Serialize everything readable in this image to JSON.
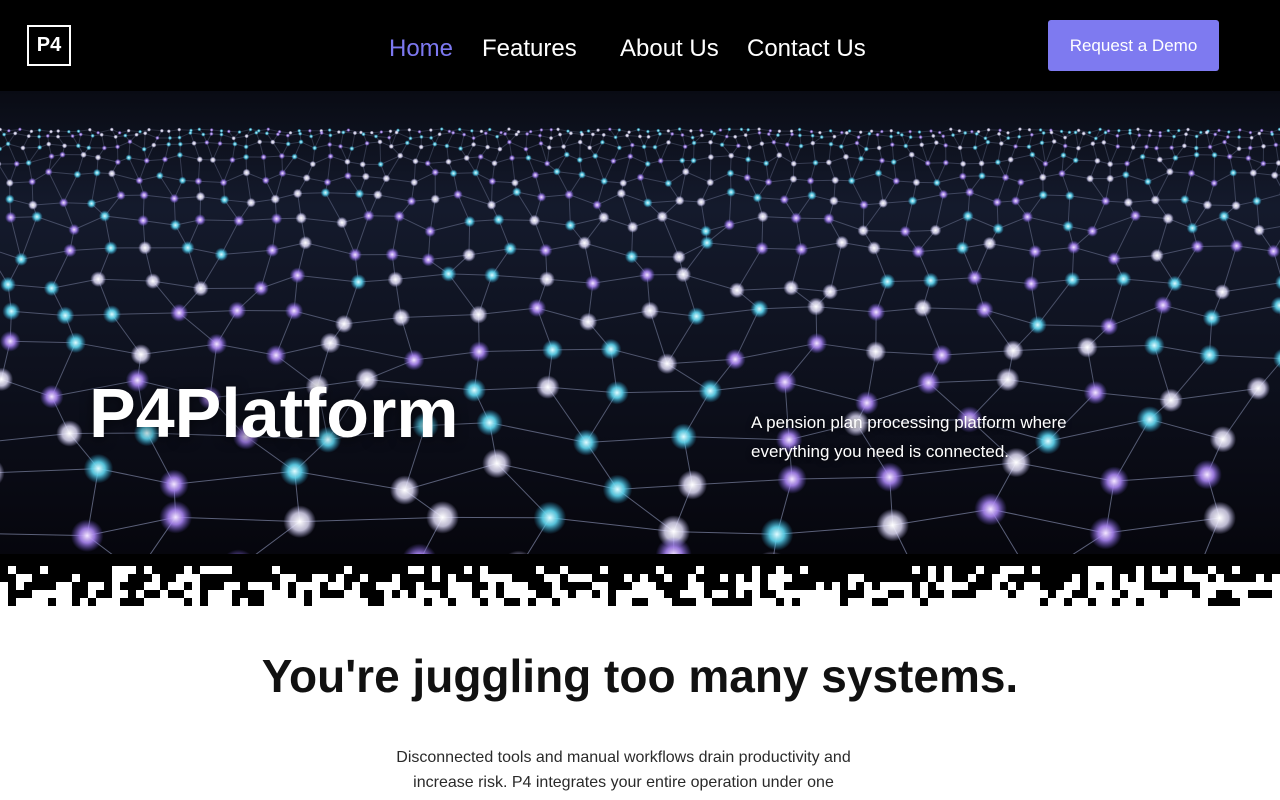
{
  "header": {
    "logo_text": "P4",
    "nav": {
      "home": "Home",
      "features": "Features",
      "about": "About Us",
      "contact": "Contact Us"
    },
    "cta_label": "Request a Demo",
    "accent_color": "#7e7af0"
  },
  "hero": {
    "title": "P4Platform",
    "subtitle": "A pension plan processing platform where everything you need is connected."
  },
  "intro": {
    "heading": "You're juggling too many systems.",
    "body": "Disconnected tools and manual workflows drain productivity and increase risk. P4 integrates your entire operation under one"
  }
}
